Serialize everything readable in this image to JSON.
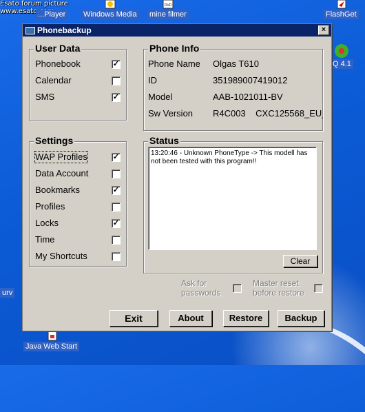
{
  "watermark": {
    "line1": "Esato forum picture",
    "line2": "www.esato.com"
  },
  "desktop": {
    "icons": {
      "player": "...Player",
      "windows_media": "Windows Media",
      "mine_filmer": "mine filmer",
      "flashget": "FlashGet",
      "icq": "Q 4.1",
      "java": "Java Web Start",
      "left_partial": "urv"
    }
  },
  "window": {
    "title": "Phonebackup",
    "close": "×"
  },
  "user_data": {
    "title": "User Data",
    "items": [
      {
        "label": "Phonebook",
        "checked": true
      },
      {
        "label": "Calendar",
        "checked": false
      },
      {
        "label": "SMS",
        "checked": true
      }
    ]
  },
  "phone_info": {
    "title": "Phone Info",
    "rows": [
      {
        "key": "Phone Name",
        "value": "Olgas T610"
      },
      {
        "key": "ID",
        "value": "351989007419012"
      },
      {
        "key": "Model",
        "value": "AAB-1021011-BV"
      },
      {
        "key": "Sw Version",
        "value": "R4C003    CXC125568_EU_"
      }
    ]
  },
  "settings": {
    "title": "Settings",
    "items": [
      {
        "label": "WAP Profiles",
        "checked": true
      },
      {
        "label": "Data Account",
        "checked": false
      },
      {
        "label": "Bookmarks",
        "checked": true
      },
      {
        "label": "Profiles",
        "checked": false
      },
      {
        "label": "Locks",
        "checked": true
      },
      {
        "label": "Time",
        "checked": false
      },
      {
        "label": "My Shortcuts",
        "checked": false
      }
    ]
  },
  "status": {
    "title": "Status",
    "text": "13:20:46 - Unknown PhoneType -> This modell has not been tested with this program!!",
    "clear_label": "Clear"
  },
  "options": {
    "ask_line1": "Ask for",
    "ask_line2": "passwords",
    "master_line1": "Master reset",
    "master_line2": "before restore"
  },
  "buttons": {
    "exit": "Exit",
    "about": "About",
    "restore": "Restore",
    "backup": "Backup"
  }
}
